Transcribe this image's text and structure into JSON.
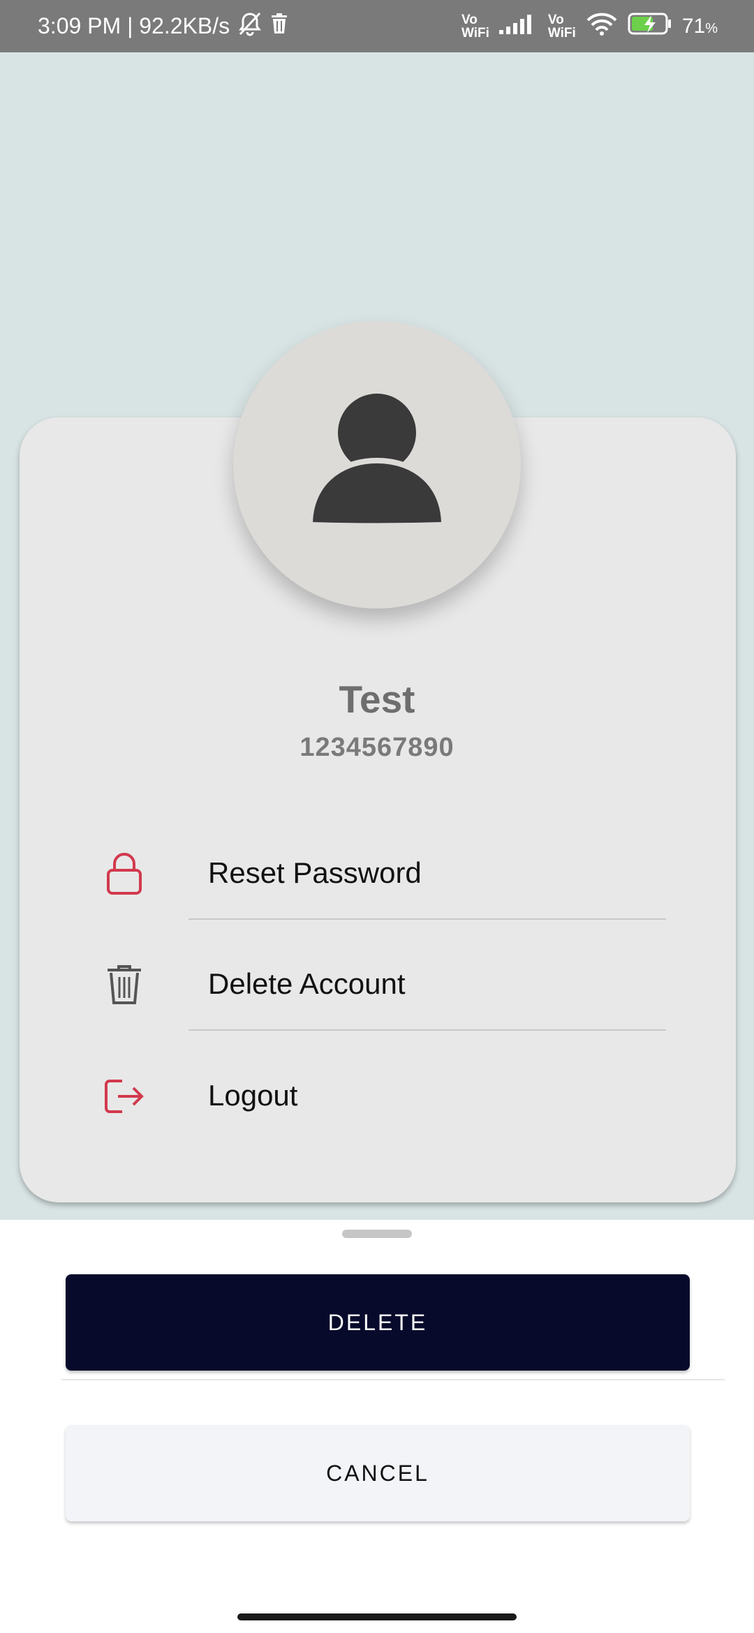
{
  "status_bar": {
    "time_speed": "3:09 PM | 92.2KB/s",
    "vowifi_top": "Vo",
    "vowifi_bottom": "WiFi",
    "battery_percent": "71",
    "battery_unit": "%"
  },
  "profile": {
    "name": "Test",
    "phone": "1234567890"
  },
  "menu": {
    "items": [
      {
        "label": "Reset Password",
        "icon": "lock-icon"
      },
      {
        "label": "Delete Account",
        "icon": "trash-icon"
      },
      {
        "label": "Logout",
        "icon": "logout-icon"
      }
    ]
  },
  "dialog": {
    "delete_label": "DELETE",
    "cancel_label": "CANCEL"
  },
  "colors": {
    "background": "#d8e3e3",
    "card": "#e8e8e8",
    "accent_red": "#d2394d",
    "delete_button": "#070a2b",
    "cancel_button": "#f3f4f8"
  }
}
